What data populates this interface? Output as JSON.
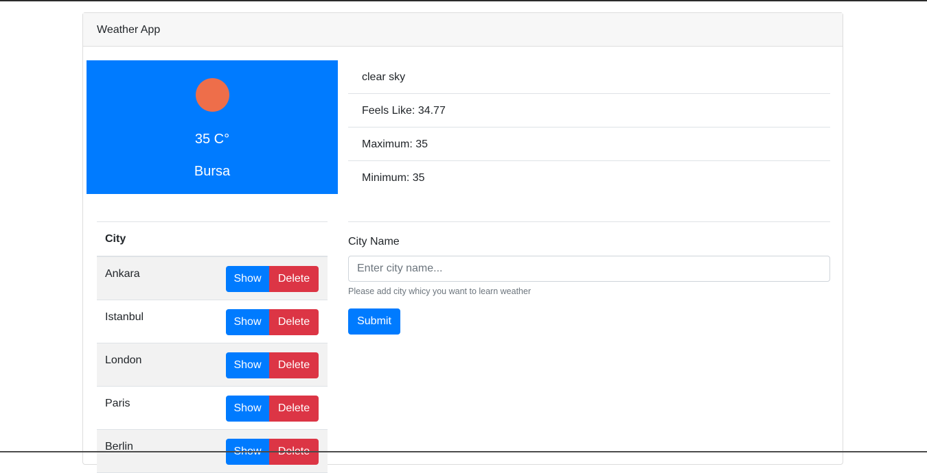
{
  "app": {
    "title": "Weather App"
  },
  "current": {
    "icon": "sun-icon",
    "temperature": "35 C°",
    "city": "Bursa",
    "description": "clear sky",
    "feels_like": "Feels Like: 34.77",
    "maximum": "Maximum: 35",
    "minimum": "Minimum: 35"
  },
  "colors": {
    "primary": "#007bff",
    "danger": "#dc3545",
    "sun": "#ee6e4a"
  },
  "table": {
    "header": "City",
    "show_label": "Show",
    "delete_label": "Delete",
    "rows": [
      {
        "city": "Ankara"
      },
      {
        "city": "Istanbul"
      },
      {
        "city": "London"
      },
      {
        "city": "Paris"
      },
      {
        "city": "Berlin"
      }
    ]
  },
  "form": {
    "label": "City Name",
    "placeholder": "Enter city name...",
    "value": "",
    "help": "Please add city whicy you want to learn weather",
    "submit_label": "Submit"
  }
}
